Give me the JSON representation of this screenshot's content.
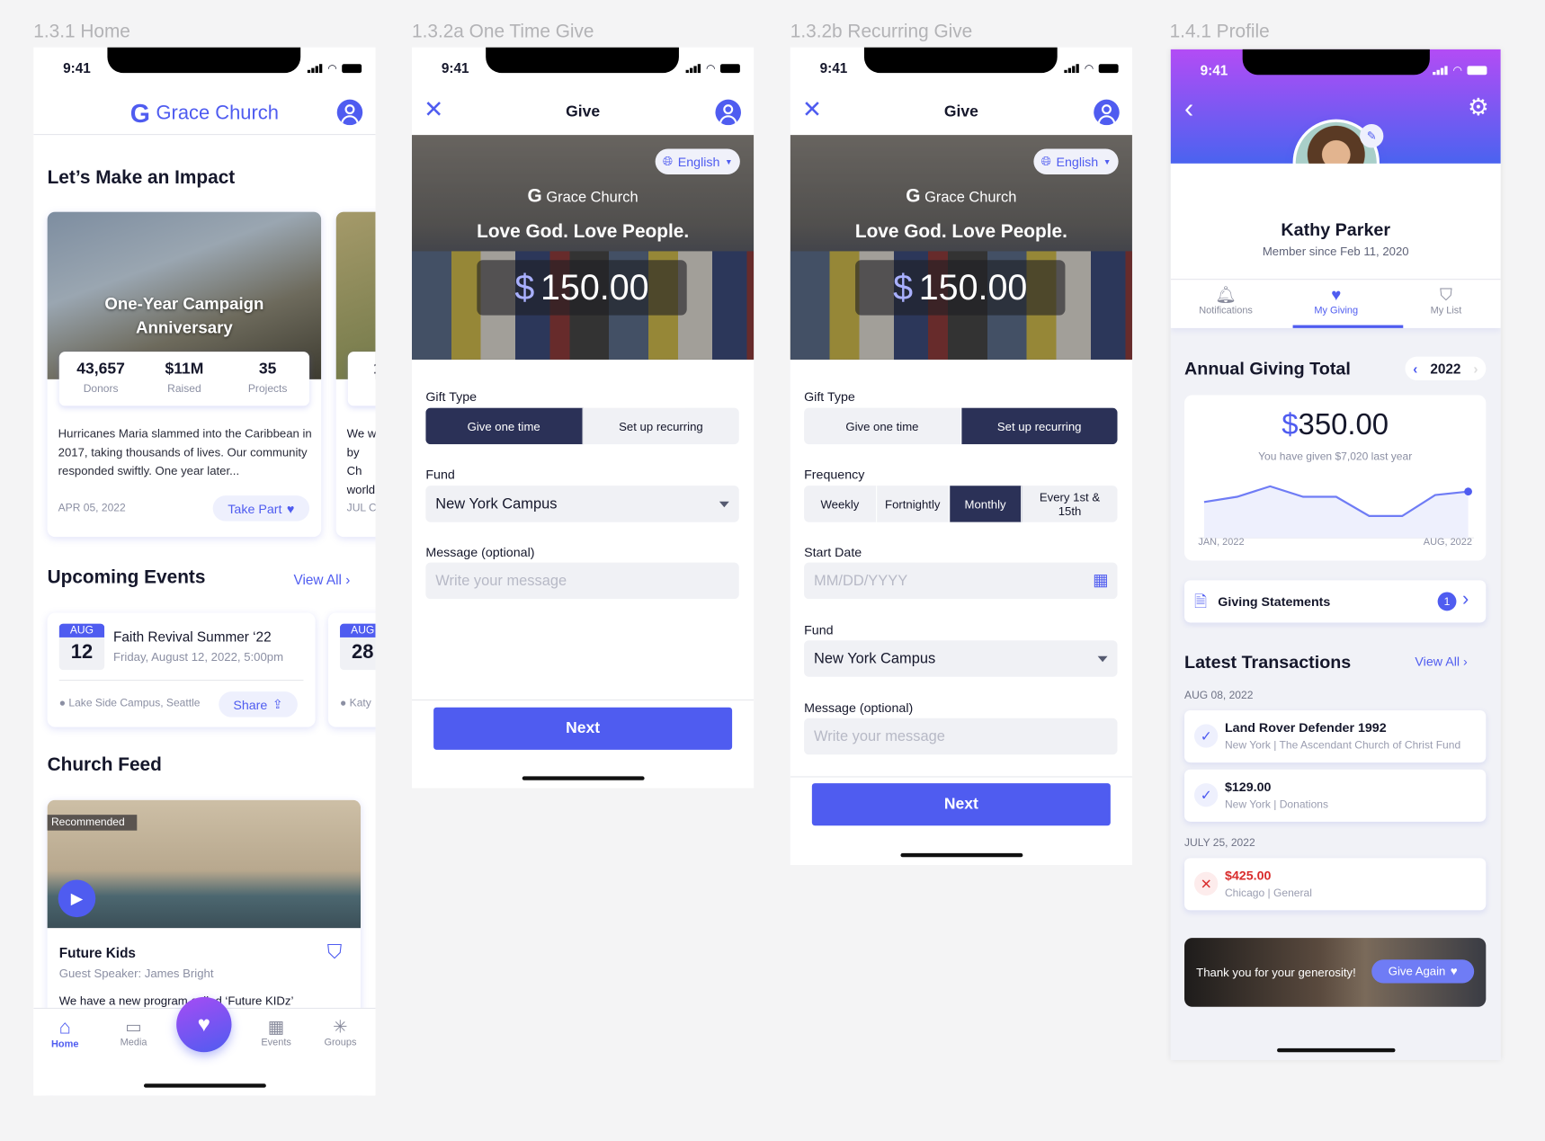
{
  "screen_labels": [
    "1.3.1 Home",
    "1.3.2a One Time Give",
    "1.3.2b Recurring Give",
    "1.4.1 Profile"
  ],
  "status_time": "9:41",
  "colors": {
    "accent": "#4f5cf0",
    "dark_segment": "#2b3157",
    "error": "#d92c2c",
    "profile_gradient": [
      "#b34cf5",
      "#4a63f0"
    ]
  },
  "home": {
    "brand": "Grace Church",
    "impact_heading": "Let’s Make an Impact",
    "campaign": {
      "title": "One-Year Campaign Anniversary",
      "stats": [
        {
          "value": "43,657",
          "label": "Donors"
        },
        {
          "value": "$11M",
          "label": "Raised"
        },
        {
          "value": "35",
          "label": "Projects"
        }
      ],
      "description": "Hurricanes Maria slammed into the Caribbean in 2017, taking thousands of lives. Our community responded swiftly. One year later...",
      "date": "APR 05, 2022",
      "cta": "Take Part"
    },
    "campaign2": {
      "stat": "1",
      "description": "We w by Ch world",
      "date": "JUL C"
    },
    "events_heading": "Upcoming Events",
    "view_all": "View All",
    "event": {
      "month": "AUG",
      "day": "12",
      "title": "Faith Revival Summer ‘22",
      "datetime": "Friday, August 12, 2022, 5:00pm",
      "location": "Lake Side Campus, Seattle",
      "share": "Share"
    },
    "event2": {
      "month": "AUG",
      "day": "28",
      "location": "Katy"
    },
    "feed_heading": "Church Feed",
    "feed": {
      "badge": "Recommended",
      "title": "Future Kids",
      "subtitle": "Guest Speaker: James Bright",
      "text": "We have a new program called ‘Future KIDz’"
    },
    "tabs": [
      {
        "label": "Home",
        "icon": "home-icon"
      },
      {
        "label": "Media",
        "icon": "monitor-icon"
      },
      {
        "label": "Events",
        "icon": "calendar-icon"
      },
      {
        "label": "Groups",
        "icon": "sparkle-icon"
      }
    ]
  },
  "give_one": {
    "title": "Give",
    "language": "English",
    "brand": "Grace Church",
    "tagline": "Love God. Love People.",
    "currency": "$",
    "amount": "150.00",
    "gift_type_label": "Gift Type",
    "gift_types": [
      "Give one time",
      "Set up recurring"
    ],
    "fund_label": "Fund",
    "fund_value": "New York Campus",
    "message_label": "Message (optional)",
    "message_placeholder": "Write your message",
    "next": "Next"
  },
  "give_recurring": {
    "title": "Give",
    "language": "English",
    "brand": "Grace Church",
    "tagline": "Love God. Love People.",
    "currency": "$",
    "amount": "150.00",
    "gift_type_label": "Gift Type",
    "gift_types": [
      "Give one time",
      "Set up recurring"
    ],
    "frequency_label": "Frequency",
    "frequencies": [
      "Weekly",
      "Fortnightly",
      "Monthly",
      "Every 1st & 15th"
    ],
    "start_date_label": "Start Date",
    "start_date_placeholder": "MM/DD/YYYY",
    "fund_label": "Fund",
    "fund_value": "New York Campus",
    "message_label": "Message (optional)",
    "message_placeholder": "Write your message",
    "next": "Next"
  },
  "profile": {
    "name": "Kathy Parker",
    "member_since": "Member since Feb 11, 2020",
    "tabs": [
      "Notifications",
      "My Giving",
      "My List"
    ],
    "annual_heading": "Annual Giving Total",
    "year": "2022",
    "total_currency": "$",
    "total": "350.00",
    "last_year": "You have given $7,020 last year",
    "chart_data": {
      "type": "area",
      "x_start": "JAN, 2022",
      "x_end": "AUG, 2022",
      "values": [
        40,
        46,
        58,
        46,
        46,
        24,
        24,
        48,
        52
      ]
    },
    "statements": "Giving Statements",
    "statements_count": "1",
    "transactions_heading": "Latest Transactions",
    "view_all": "View All",
    "groups": [
      {
        "date": "AUG 08, 2022",
        "items": [
          {
            "title": "Land Rover Defender 1992",
            "location": "New York",
            "fund": "The Ascendant Church of Christ Fund",
            "status": "success"
          },
          {
            "title": "$129.00",
            "location": "New York",
            "fund": "Donations",
            "status": "success"
          }
        ]
      },
      {
        "date": "JULY 25, 2022",
        "items": [
          {
            "title": "$425.00",
            "location": "Chicago",
            "fund": "General",
            "status": "failed"
          }
        ]
      }
    ],
    "banner_text": "Thank you for your generosity!",
    "banner_cta": "Give Again"
  }
}
